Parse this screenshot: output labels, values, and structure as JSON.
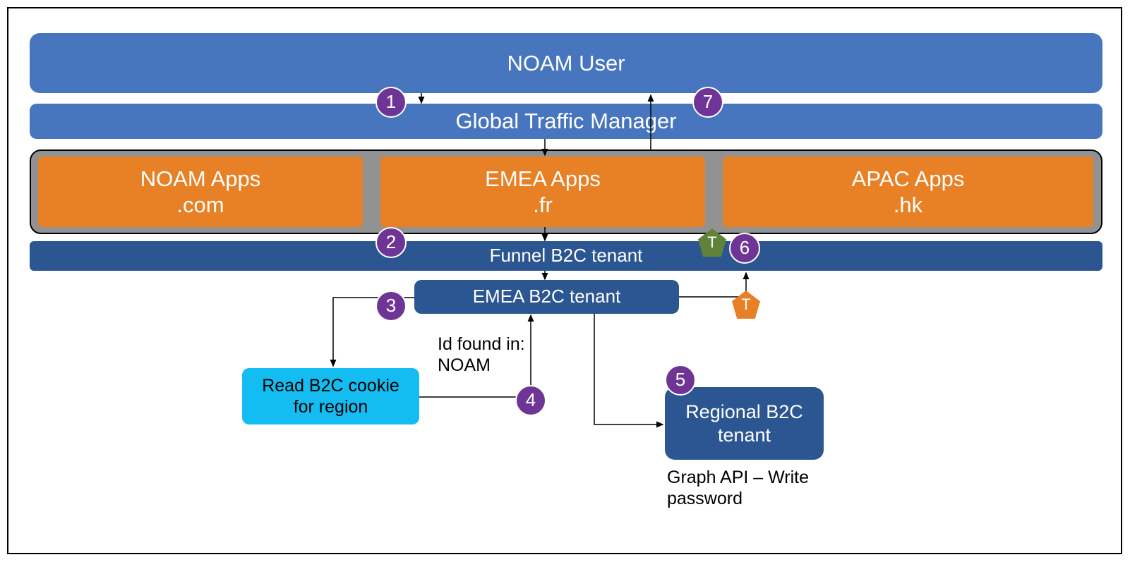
{
  "boxes": {
    "noam_user": "NOAM User",
    "gtm": "Global Traffic Manager",
    "funnel": "Funnel B2C tenant",
    "emea_tenant": "EMEA B2C tenant",
    "regional": "Regional B2C\ntenant",
    "cookie": "Read B2C cookie\nfor region"
  },
  "apps": {
    "noam": "NOAM Apps\n.com",
    "emea": "EMEA Apps\n.fr",
    "apac": "APAC Apps\n.hk"
  },
  "steps": {
    "s1": "1",
    "s2": "2",
    "s3": "3",
    "s4": "4",
    "s5": "5",
    "s6": "6",
    "s7": "7"
  },
  "tokens": {
    "green": "T",
    "orange": "T"
  },
  "notes": {
    "id_found": "Id found in:\nNOAM",
    "graph": "Graph API – Write\npassword"
  }
}
